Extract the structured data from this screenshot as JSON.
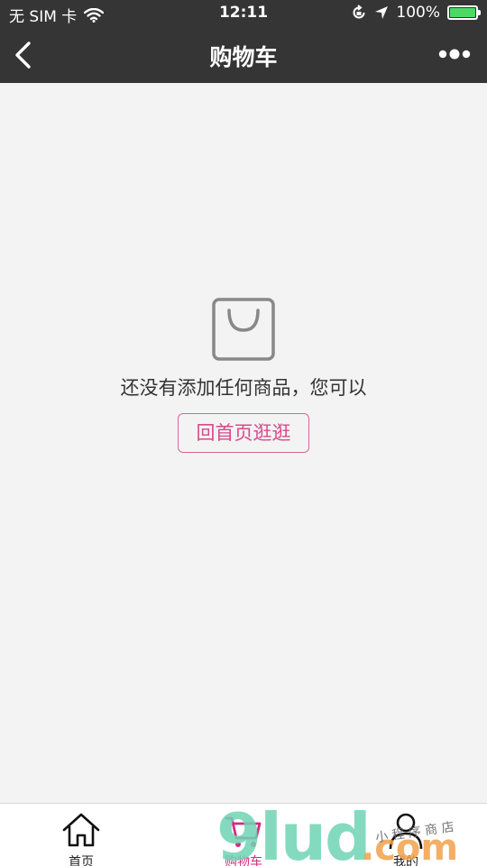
{
  "status_bar": {
    "carrier": "无 SIM 卡",
    "time": "12:11",
    "battery": "100%",
    "wifi_icon": "wifi-icon",
    "location_icon": "location-arrow-icon",
    "lock_icon": "rotation-lock-icon"
  },
  "nav": {
    "title": "购物车",
    "back_icon": "chevron-left-icon",
    "more_icon": "more-dots-icon"
  },
  "empty_state": {
    "icon": "shopping-bag-icon",
    "message": "还没有添加任何商品，您可以",
    "button_label": "回首页逛逛"
  },
  "tabbar": {
    "items": [
      {
        "label": "首页",
        "icon": "home-icon",
        "active": false
      },
      {
        "label": "购物车",
        "icon": "cart-icon",
        "active": true
      },
      {
        "label": "我的",
        "icon": "user-icon",
        "active": false
      }
    ]
  },
  "watermark": {
    "brand": "9lud",
    "suffix": ".com",
    "tagline": "小 程 序 商 店"
  },
  "colors": {
    "nav_bg": "#353535",
    "page_bg": "#f3f3f3",
    "accent": "#d64b8c",
    "battery": "#4cd964"
  }
}
